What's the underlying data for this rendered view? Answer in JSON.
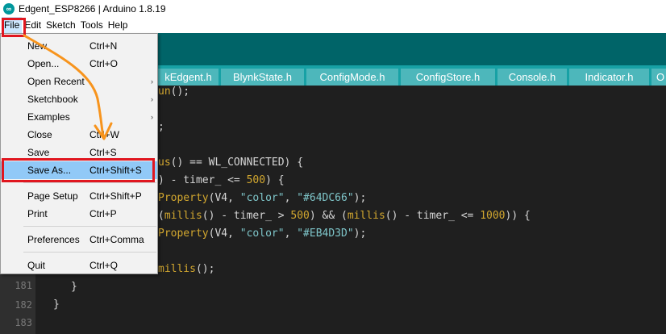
{
  "window": {
    "title": "Edgent_ESP8266 | Arduino 1.8.19",
    "logo_glyph": "∞"
  },
  "menubar": {
    "items": [
      "File",
      "Edit",
      "Sketch",
      "Tools",
      "Help"
    ]
  },
  "tabs": [
    "kEdgent.h",
    "BlynkState.h",
    "ConfigMode.h",
    "ConfigStore.h",
    "Console.h",
    "Indicator.h",
    "O"
  ],
  "file_menu": {
    "items": [
      {
        "label": "New",
        "shortcut": "Ctrl+N"
      },
      {
        "label": "Open...",
        "shortcut": "Ctrl+O"
      },
      {
        "label": "Open Recent",
        "shortcut": "",
        "submenu_arrow": "›"
      },
      {
        "label": "Sketchbook",
        "shortcut": "",
        "submenu_arrow": "›"
      },
      {
        "label": "Examples",
        "shortcut": "",
        "submenu_arrow": "›"
      },
      {
        "label": "Close",
        "shortcut": "Ctrl+W"
      },
      {
        "label": "Save",
        "shortcut": "Ctrl+S"
      },
      {
        "label": "Save As...",
        "shortcut": "Ctrl+Shift+S"
      },
      {
        "label": "Page Setup",
        "shortcut": "Ctrl+Shift+P"
      },
      {
        "label": "Print",
        "shortcut": "Ctrl+P"
      },
      {
        "label": "Preferences",
        "shortcut": "Ctrl+Comma"
      },
      {
        "label": "Quit",
        "shortcut": "Ctrl+Q"
      }
    ]
  },
  "editor": {
    "line_numbers": [
      "181",
      "182",
      "183"
    ],
    "code": {
      "l1_fn": "un",
      "l1_rest": "();",
      "l2": ";",
      "l3_fn": "us",
      "l3_rest": "() == WL_CONNECTED) {",
      "l4_a": ") - timer_ <= ",
      "l4_num": "500",
      "l4_b": ") {",
      "l5_fn": "Property",
      "l5_a": "(V4, ",
      "l5_s1": "\"color\"",
      "l5_b": ", ",
      "l5_s2": "\"#64DC66\"",
      "l5_c": ");",
      "l6_a": "(",
      "l6_fn1": "millis",
      "l6_b": "() - timer_ > ",
      "l6_num1": "500",
      "l6_c": ") && (",
      "l6_fn2": "millis",
      "l6_d": "() - timer_ <= ",
      "l6_num2": "1000",
      "l6_e": ")) {",
      "l7_fn": "Property",
      "l7_a": "(V4, ",
      "l7_s1": "\"color\"",
      "l7_b": ", ",
      "l7_s2": "\"#EB4D3D\"",
      "l7_c": ");",
      "l8_fn": "millis",
      "l8_rest": "();",
      "l9": "}",
      "l10": "}"
    }
  },
  "colors": {
    "toolbar": "#006468",
    "tabbar": "#17a1a5",
    "tab": "#4db7bb",
    "highlight": "#e0161f",
    "arrow": "#f7941d",
    "selected_item": "#91c9f7"
  }
}
